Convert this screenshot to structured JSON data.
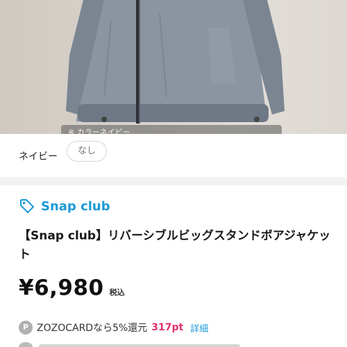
{
  "photo": {
    "image_icon": "jacket-photo",
    "caption": "※ カラーネイビー…"
  },
  "variant": {
    "label": "ネイビー",
    "chip_label": "なし"
  },
  "brand": {
    "icon": "tag-icon",
    "name": "Snap club",
    "color": "#1c9ad6"
  },
  "product": {
    "title": "【Snap club】リバーシブルビッグスタンドボアジャケット",
    "price": "¥6,980",
    "tax_label": "税込"
  },
  "points": {
    "badge": "P",
    "text": "ZOZOCARDなら5%還元",
    "value": "317pt",
    "detail_label": "詳細",
    "value_color": "#e0306a"
  }
}
